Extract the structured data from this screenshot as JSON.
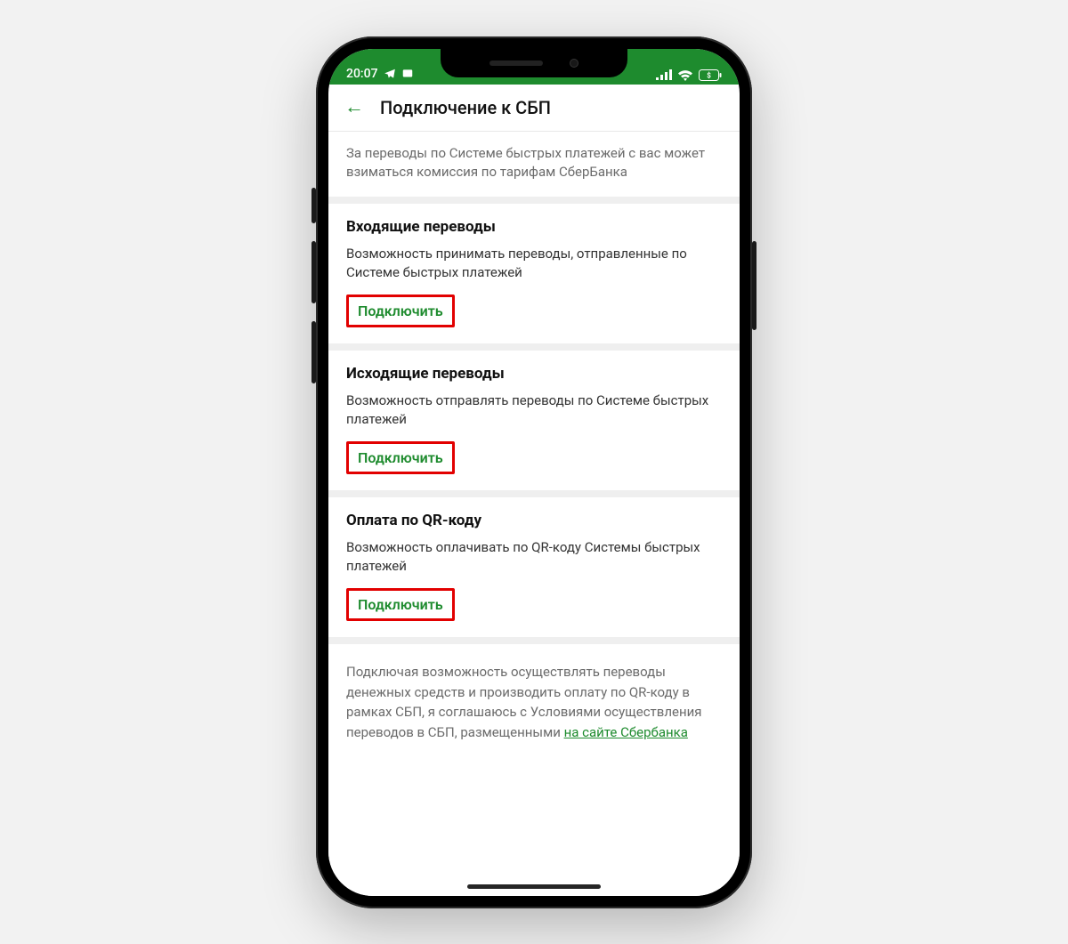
{
  "status": {
    "time": "20:07",
    "icons_left": [
      "telegram-icon",
      "message-icon"
    ],
    "icons_right": [
      "signal-icon",
      "wifi-icon",
      "battery-icon"
    ]
  },
  "header": {
    "title": "Подключение к СБП"
  },
  "note": "За переводы по Системе быстрых платежей с вас может взиматься комиссия по тарифам СберБанка",
  "sections": [
    {
      "title": "Входящие переводы",
      "desc": "Возможность принимать переводы, отправленные по Системе быстрых платежей",
      "button": "Подключить"
    },
    {
      "title": "Исходящие переводы",
      "desc": "Возможность отправлять переводы по Системе быстрых платежей",
      "button": "Подключить"
    },
    {
      "title": "Оплата по QR-коду",
      "desc": "Возможность оплачивать по QR-коду Системы быстрых платежей",
      "button": "Подключить"
    }
  ],
  "disclaimer": {
    "text": "Подключая возможность осуществлять переводы денежных средств и производить оплату по QR-коду в рамках СБП, я соглашаюсь с Условиями осуществления переводов в СБП, размещенными ",
    "link_text": "на сайте Сбербанка"
  }
}
